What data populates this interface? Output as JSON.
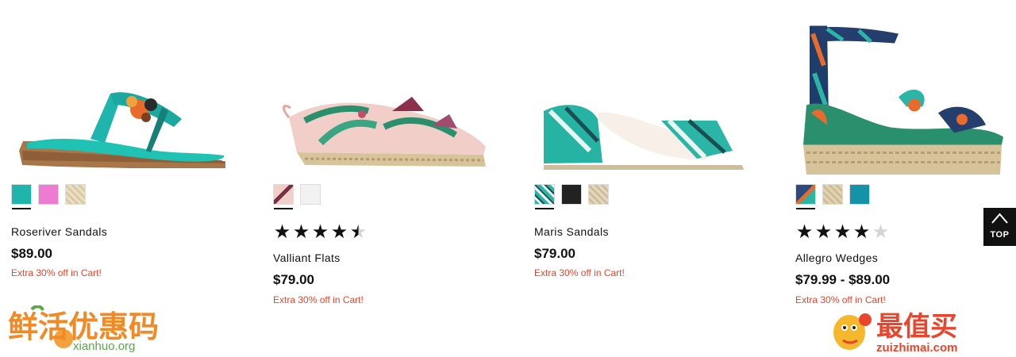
{
  "products": [
    {
      "name": "Roseriver Sandals",
      "price": "$89.00",
      "promo": "Extra 30% off in Cart!",
      "swatches": [
        {
          "color": "#1fb5ad",
          "selected": true
        },
        {
          "color": "#ee7bd2",
          "selected": false
        },
        {
          "color": "#e8dcc0",
          "selected": false
        }
      ]
    },
    {
      "name": "Valliant Flats",
      "price": "$79.00",
      "promo": "Extra 30% off in Cart!",
      "rating": 4.5,
      "swatches": [
        {
          "color": "#e7c6bf",
          "selected": true
        },
        {
          "color": "#f2f2f2",
          "selected": false
        }
      ]
    },
    {
      "name": "Maris Sandals",
      "price": "$79.00",
      "promo": "Extra 30% off in Cart!",
      "swatches": [
        {
          "color": "#2bb3a8",
          "selected": true
        },
        {
          "color": "#222222",
          "selected": false
        },
        {
          "color": "#d8ccb2",
          "selected": false
        }
      ]
    },
    {
      "name": "Allegro Wedges",
      "price": "$79.99 - $89.00",
      "promo": "Extra 30% off in Cart!",
      "rating": 4,
      "swatches": [
        {
          "color": "#2c4a7a",
          "selected": true
        },
        {
          "color": "#d9cba7",
          "selected": false
        },
        {
          "color": "#1492a8",
          "selected": false
        }
      ]
    }
  ],
  "top_button": {
    "label": "TOP"
  },
  "watermarks": {
    "left": {
      "text": "鲜活优惠码",
      "url": "xianhuo.org"
    },
    "right": {
      "text": "最值买",
      "url": "zuizhimai.com"
    }
  },
  "colors": {
    "promo": "#e8452c",
    "teal": "#1fb5ad",
    "pink": "#ee7bd2",
    "text": "#111111"
  }
}
